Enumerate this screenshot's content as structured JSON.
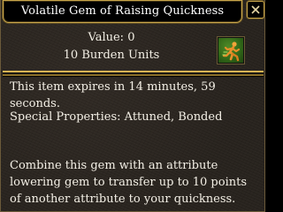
{
  "window": {
    "title": "Volatile Gem of Raising Quickness"
  },
  "item": {
    "value_text": "Value: 0",
    "burden_text": "10 Burden Units",
    "icon": "running-figure-gem-icon",
    "expires_text": "This item expires in 14 minutes, 59 seconds.",
    "special_properties_text": "Special Properties: Attuned, Bonded",
    "description": "Combine this gem with an attribute lowering gem to transfer up to 10 points of another attribute to your quickness."
  },
  "colors": {
    "panel_bg": "#2b2621",
    "border_gold": "#c9a64b",
    "text": "#f4f0e6",
    "icon_green": "#2f6417",
    "icon_orange": "#e8902a"
  }
}
